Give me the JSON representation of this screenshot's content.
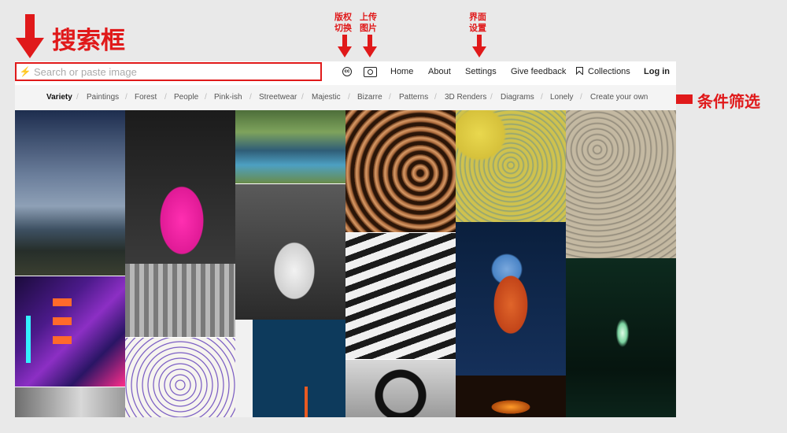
{
  "search": {
    "placeholder": "Search or paste image"
  },
  "nav": {
    "home": "Home",
    "about": "About",
    "settings": "Settings",
    "feedback": "Give feedback",
    "collections": "Collections",
    "login": "Log in"
  },
  "filters": [
    "Variety",
    "Paintings",
    "Forest",
    "People",
    "Pink-ish",
    "Streetwear",
    "Majestic",
    "Bizarre",
    "Patterns",
    "3D Renders",
    "Diagrams",
    "Lonely",
    "Create your own"
  ],
  "annotations": {
    "search_box": "搜索框",
    "license": "版权\n切换",
    "upload": "上传\n图片",
    "settings": "界面\n设置",
    "filters": "条件筛选"
  },
  "colors": {
    "annotation_red": "#e0191a",
    "filter_bar": "#f4f4f4",
    "page_bg": "#e9e9e9"
  }
}
